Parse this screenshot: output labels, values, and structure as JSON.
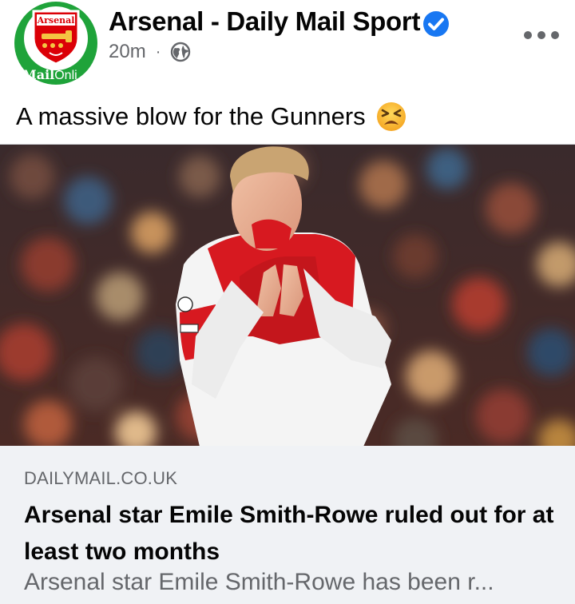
{
  "post": {
    "page_name": "Arsenal - Daily Mail Sport",
    "verified": true,
    "time_ago": "20m",
    "separator": "·",
    "audience_icon": "globe-icon",
    "more_icon": "more-options-icon",
    "avatar": {
      "crest_text": "Arsenal",
      "brand_text_bold": "Mail",
      "brand_text_light": "Onli"
    },
    "caption": "A massive blow for the Gunners",
    "caption_emoji": "tired-face-emoji",
    "photo_alt_icon": "football-player-photo",
    "link": {
      "domain": "DAILYMAIL.CO.UK",
      "headline": "Arsenal star Emile Smith-Rowe ruled out for at least two months",
      "description": "Arsenal star Emile Smith-Rowe has been r..."
    }
  },
  "colors": {
    "verified_blue": "#1877f2",
    "avatar_green": "#1fa33a",
    "arsenal_red": "#db0007",
    "secondary_text": "#65676b",
    "card_bg": "#f0f2f5"
  }
}
